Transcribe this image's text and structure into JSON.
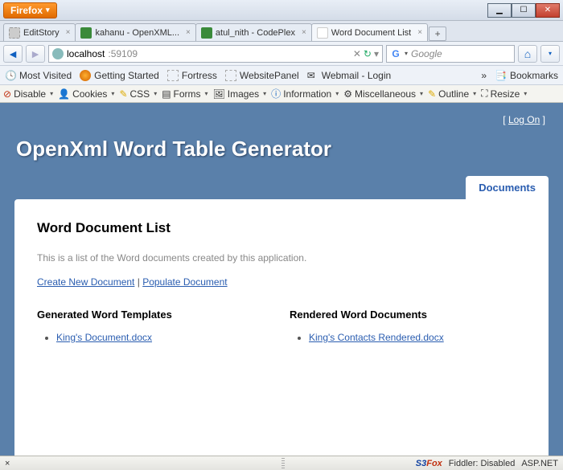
{
  "titlebar": {
    "app": "Firefox"
  },
  "tabs": [
    {
      "label": "EditStory"
    },
    {
      "label": "kahanu - OpenXML..."
    },
    {
      "label": "atul_nith - CodePlex"
    },
    {
      "label": "Word Document List"
    }
  ],
  "newtab": "+",
  "url": {
    "host": "localhost",
    "port": ":59109"
  },
  "search": {
    "placeholder": "Google"
  },
  "bookmarks": [
    "Most Visited",
    "Getting Started",
    "Fortress",
    "WebsitePanel",
    "Webmail - Login"
  ],
  "bookmarks_folder": "Bookmarks",
  "dev": [
    "Disable",
    "Cookies",
    "CSS",
    "Forms",
    "Images",
    "Information",
    "Miscellaneous",
    "Outline",
    "Resize"
  ],
  "page": {
    "logon": "Log On",
    "title": "OpenXml Word Table Generator",
    "navtab": "Documents",
    "heading": "Word Document List",
    "intro": "This is a list of the Word documents created by this application.",
    "link_create": "Create New Document",
    "link_populate": "Populate Document",
    "col1_title": "Generated Word Templates",
    "col1_item": "King's Document.docx",
    "col2_title": "Rendered Word Documents",
    "col2_item": "King's Contacts Rendered.docx"
  },
  "status": {
    "s3": "S3Fox",
    "fiddler": "Fiddler: Disabled",
    "asp": "ASP.NET"
  }
}
